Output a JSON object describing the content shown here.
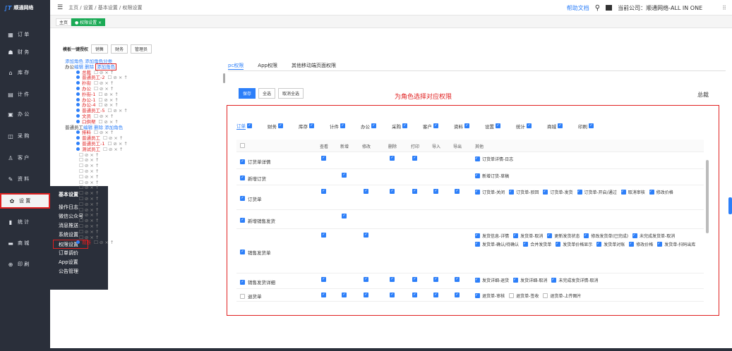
{
  "sidebar": {
    "logo": "顺通网络",
    "items": [
      {
        "name": "order",
        "icon": "▦",
        "label": "订 单"
      },
      {
        "name": "finance",
        "icon": "☗",
        "label": "财 务"
      },
      {
        "name": "stock",
        "icon": "⌂",
        "label": "库 存"
      },
      {
        "name": "piece",
        "icon": "▤",
        "label": "计 件"
      },
      {
        "name": "office",
        "icon": "▣",
        "label": "办 公"
      },
      {
        "name": "purchase",
        "icon": "◫",
        "label": "采 购"
      },
      {
        "name": "customer",
        "icon": "♙",
        "label": "客 户"
      },
      {
        "name": "data",
        "icon": "✎",
        "label": "资 料"
      },
      {
        "name": "settings",
        "icon": "✿",
        "label": "设 置"
      },
      {
        "name": "stats",
        "icon": "▮",
        "label": "统 计"
      },
      {
        "name": "mall",
        "icon": "▬",
        "label": "商 城"
      },
      {
        "name": "print",
        "icon": "⊕",
        "label": "印 刷"
      }
    ]
  },
  "flyout": {
    "title": "基本设置",
    "items": [
      "操作日志",
      "微信公众号",
      "消息推送",
      "系统设置",
      "权限设置",
      "订单调价",
      "App设置",
      "公告管理"
    ]
  },
  "topbar": {
    "menu_icon": "☰",
    "crumb": "主页 / 设置 / 基本设置 / 权限设置",
    "help": "帮助文档",
    "search_icon": "⚲",
    "company": "当前公司：顺通网络-ALL IN ONE"
  },
  "tabs": {
    "home": "主页",
    "current": "● 权限设置 ×"
  },
  "quick": {
    "label": "模板一键授权",
    "buttons": [
      "销售",
      "财务",
      "管理员"
    ]
  },
  "tree": {
    "add_role": "添加角色",
    "add_class": "添加角色分类",
    "group1": "办公",
    "edit": "编辑",
    "del": "删除",
    "add": "添加角色",
    "nodes1": [
      "总裁",
      "普通员工-2",
      "扑街",
      "办公",
      "扑街-1",
      "办公-1",
      "办公-4",
      "普通员工-5",
      "文员",
      "口供帮"
    ],
    "group2": "普通员工",
    "nodes2": [
      "排料",
      "普通员工",
      "普通员工-1",
      "测试员工"
    ],
    "last": "裁断",
    "ops": "☐ ⊘ × ↑"
  },
  "ptabs": [
    "pc权限",
    "App权限",
    "其他移动端页面权限"
  ],
  "actions": {
    "save": "保存",
    "all": "全选",
    "cancel": "取消全选"
  },
  "hint": "为角色选择对应权限",
  "role": "总裁",
  "modules": [
    "订单",
    "财务",
    "库存",
    "计件",
    "办公",
    "采购",
    "客户",
    "资料",
    "设置",
    "统计",
    "商城",
    "印刷"
  ],
  "cols": [
    "查看",
    "新增",
    "修改",
    "删除",
    "打印",
    "导入",
    "导出",
    "其他"
  ],
  "rows": [
    {
      "name": "订货单详情",
      "on": true,
      "cells": [
        1,
        0,
        0,
        1,
        1,
        0,
        0
      ],
      "others": [
        "订货单详情-日志"
      ]
    },
    {
      "name": "新增订货",
      "on": true,
      "cells": [
        0,
        1,
        0,
        0,
        0,
        0,
        0
      ],
      "others": [
        "新增订货-草稿"
      ]
    },
    {
      "name": "订货单",
      "on": true,
      "cells": [
        1,
        0,
        1,
        1,
        1,
        1,
        1
      ],
      "others": [
        "订货单-关闭",
        "订货单-驳回",
        "订货单-发货",
        "订货单-开启/通过",
        "取消审核",
        "修改价格"
      ]
    },
    {
      "name": "新增销售发货",
      "on": true,
      "cells": [
        0,
        1,
        0,
        0,
        0,
        0,
        0
      ],
      "others": []
    },
    {
      "name": "销售发货单",
      "on": true,
      "cells": [
        1,
        0,
        1,
        0,
        0,
        0,
        0
      ],
      "others": [
        "发货信息-详情",
        "发货单-取消",
        "更新发货状态",
        "修改发货单(已完成)",
        "未完成发货单-取消",
        "发货单-确认/待确认",
        "合并发货单",
        "发货单价格显示",
        "发货单对账",
        "修改价格",
        "发货单-扫码出库"
      ]
    },
    {
      "name": "销售发货详细",
      "on": true,
      "cells": [
        1,
        0,
        1,
        1,
        1,
        1,
        1
      ],
      "others": [
        "发货详细-退货",
        "发货详细-取消",
        "未完成发货详情-取消"
      ]
    },
    {
      "name": "退货单",
      "on": false,
      "cells": [
        1,
        1,
        1,
        1,
        1,
        1,
        1
      ],
      "others": [
        "退货单-审核",
        "退货单-签收",
        "退货单-上传图片"
      ]
    }
  ]
}
